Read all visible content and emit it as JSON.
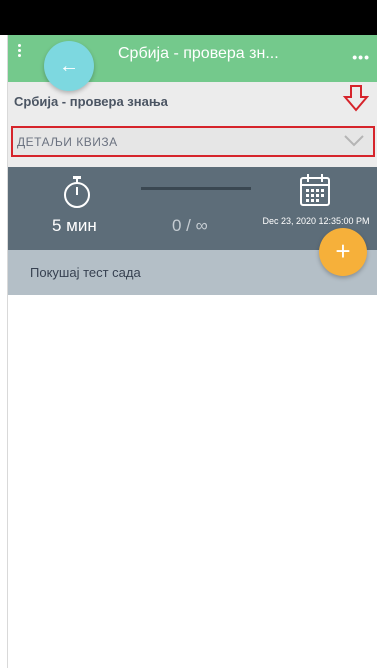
{
  "app_bar": {
    "title": "Србија - провера зн...",
    "menu_icon": "vertical-dots-icon",
    "overflow_label": "•••",
    "back_icon": "arrow-left-icon",
    "back_glyph": "←",
    "color": "#74c98c"
  },
  "quiz": {
    "title": "Србија - провера знања",
    "annotation_icon": "down-arrow-icon",
    "annotation_color": "#d6242b"
  },
  "details": {
    "label": "ДЕТАЉИ КВИЗА",
    "chevron_icon": "chevron-down-icon"
  },
  "stats": {
    "duration_icon": "stopwatch-icon",
    "duration": "5 мин",
    "attempts": "0 / ∞",
    "date_icon": "calendar-icon",
    "date": "Dec 23, 2020 12:35:00 PM",
    "color": "#5d6d79"
  },
  "fab": {
    "icon": "plus-icon",
    "glyph": "+",
    "color": "#f6b03a"
  },
  "attempt": {
    "label": "Покушај тест сада"
  }
}
